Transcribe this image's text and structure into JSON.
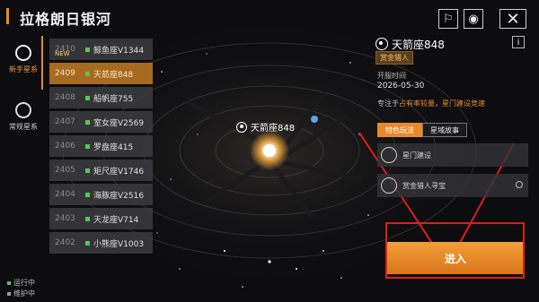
{
  "header": {
    "title": "拉格朗日银河"
  },
  "top_buttons": [
    {
      "name": "pin-icon",
      "glyph": "⚐"
    },
    {
      "name": "eye-icon",
      "glyph": "◉"
    },
    {
      "name": "close-icon",
      "glyph": "✕"
    }
  ],
  "sidebar": {
    "tabs": [
      {
        "label": "新手星系",
        "active": true
      },
      {
        "label": "常规星系",
        "active": false
      }
    ]
  },
  "galaxy_list": [
    {
      "num": "2410",
      "name": "鲸鱼座V1344",
      "new": "NEW",
      "selected": false
    },
    {
      "num": "2409",
      "name": "天箭座848",
      "selected": true
    },
    {
      "num": "2408",
      "name": "船帆座755",
      "selected": false
    },
    {
      "num": "2407",
      "name": "室女座V2569",
      "selected": false
    },
    {
      "num": "2406",
      "name": "罗盘座415",
      "selected": false
    },
    {
      "num": "2405",
      "name": "矩尺座V1746",
      "selected": false
    },
    {
      "num": "2404",
      "name": "海豚座V2516",
      "selected": false
    },
    {
      "num": "2403",
      "name": "天龙座V714",
      "selected": false
    },
    {
      "num": "2402",
      "name": "小熊座V1003",
      "selected": false
    }
  ],
  "legend": [
    {
      "label": "运行中",
      "color": "#59c35c"
    },
    {
      "label": "维护中",
      "color": "#9a9a9a"
    }
  ],
  "map": {
    "planet_label": "天箭座848"
  },
  "detail": {
    "name": "天箭座848",
    "badge": "赏金猎人",
    "info_label": "i",
    "open_label": "开服时间",
    "open_date": "2026-05-30",
    "focus_prefix": "专注于",
    "focus_1": "占有率较量",
    "focus_sep": "，",
    "focus_2": "星门建设竞速",
    "tabs": [
      "特色玩法",
      "星域故事"
    ],
    "features": [
      {
        "label": "星门建设"
      },
      {
        "label": "赏金猎人寻宝"
      }
    ],
    "enter_label": "进入"
  },
  "colors": {
    "accent": "#e98a2a",
    "annotation": "#e11d1d"
  }
}
